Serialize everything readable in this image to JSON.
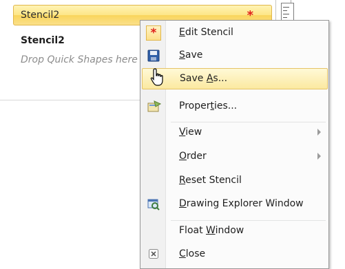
{
  "stencil": {
    "title": "Stencil2",
    "modified_marker": "*",
    "name": "Stencil2",
    "hint": "Drop Quick Shapes here"
  },
  "context_menu": {
    "items": [
      {
        "label_before": "",
        "accel": "E",
        "label_after": "dit Stencil",
        "icon": "red-star-icon"
      },
      {
        "label_before": "",
        "accel": "S",
        "label_after": "ave",
        "icon": "floppy-save-icon"
      },
      {
        "label_before": "Save ",
        "accel": "A",
        "label_after": "s...",
        "icon": ""
      },
      {
        "label_before": "Proper",
        "accel": "t",
        "label_after": "ies...",
        "icon": "properties-icon"
      },
      {
        "label_before": "",
        "accel": "V",
        "label_after": "iew",
        "icon": ""
      },
      {
        "label_before": "",
        "accel": "O",
        "label_after": "rder",
        "icon": ""
      },
      {
        "label_before": "",
        "accel": "R",
        "label_after": "eset Stencil",
        "icon": ""
      },
      {
        "label_before": "",
        "accel": "D",
        "label_after": "rawing Explorer Window",
        "icon": "drawing-explorer-icon"
      },
      {
        "label_before": "Float ",
        "accel": "W",
        "label_after": "indow",
        "icon": ""
      },
      {
        "label_before": "",
        "accel": "C",
        "label_after": "lose",
        "icon": "close-icon"
      }
    ]
  },
  "colors": {
    "highlight": "#fbe9a0",
    "title_bar": "#fde687",
    "star": "#e0201a"
  }
}
